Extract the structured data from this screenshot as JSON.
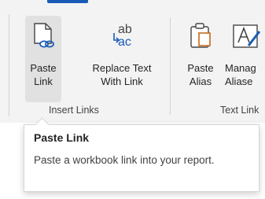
{
  "ribbon": {
    "groups": [
      {
        "label": "Insert Links",
        "buttons": [
          {
            "label_line1": "Paste",
            "label_line2": "Link",
            "icon": "paste-link-icon"
          },
          {
            "label_line1": "Replace Text",
            "label_line2": "With Link",
            "icon": "replace-text-icon",
            "icon_text_top": "ab",
            "icon_text_bottom": "ac"
          }
        ]
      },
      {
        "label": "Text Link",
        "buttons": [
          {
            "label_line1": "Paste",
            "label_line2": "Alias",
            "icon": "paste-alias-icon"
          },
          {
            "label_line1": "Manag",
            "label_line2": "Aliase",
            "icon": "manage-aliases-icon"
          }
        ]
      }
    ]
  },
  "tooltip": {
    "title": "Paste Link",
    "body": "Paste a workbook link into your report."
  },
  "colors": {
    "accent": "#1a5bb8",
    "ribbon_bg": "#f3f3f3",
    "selected_bg": "#e1e1e1"
  }
}
